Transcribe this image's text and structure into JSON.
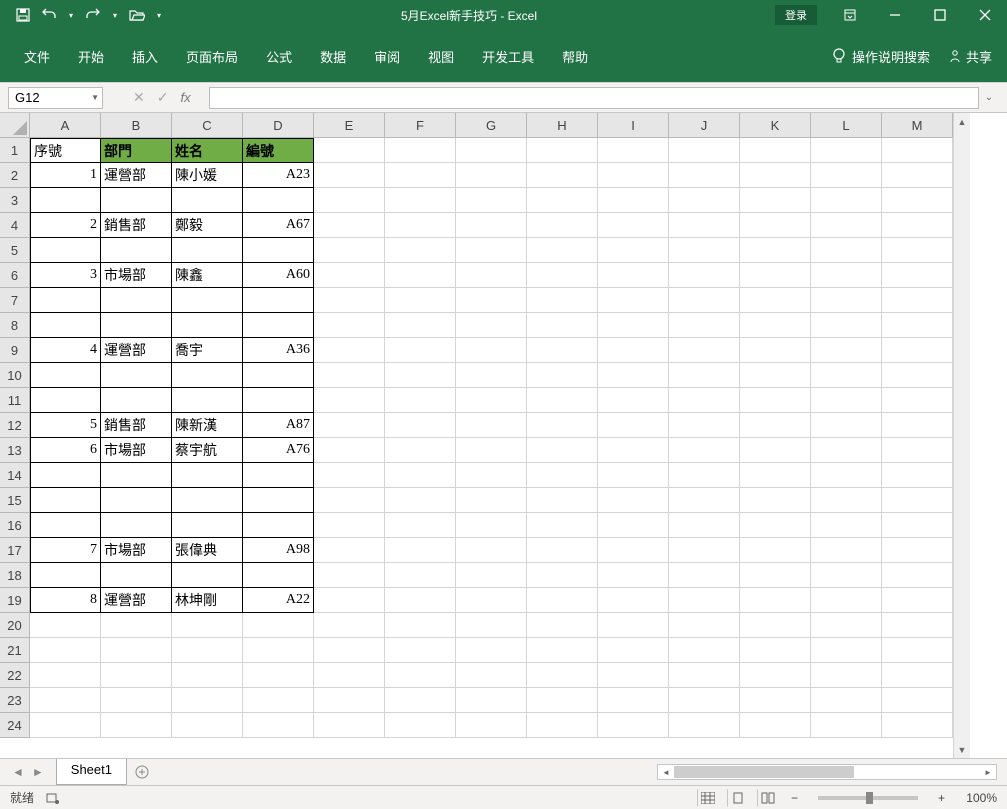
{
  "title": "5月Excel新手技巧 - Excel",
  "login_label": "登录",
  "ribbon_tabs": [
    "文件",
    "开始",
    "插入",
    "页面布局",
    "公式",
    "数据",
    "审阅",
    "视图",
    "开发工具",
    "帮助"
  ],
  "tell_me": "操作说明搜索",
  "share_label": "共享",
  "namebox_value": "G12",
  "formula_value": "",
  "column_headers": [
    "A",
    "B",
    "C",
    "D",
    "E",
    "F",
    "G",
    "H",
    "I",
    "J",
    "K",
    "L",
    "M"
  ],
  "row_count": 24,
  "sheet": {
    "headers": {
      "a": "序號",
      "b": "部門",
      "c": "姓名",
      "d": "編號"
    },
    "rows": [
      {
        "r": 2,
        "a": "1",
        "b": "運營部",
        "c": "陳小媛",
        "d": "A23"
      },
      {
        "r": 3
      },
      {
        "r": 4,
        "a": "2",
        "b": "銷售部",
        "c": "鄭毅",
        "d": "A67"
      },
      {
        "r": 5
      },
      {
        "r": 6,
        "a": "3",
        "b": "市場部",
        "c": "陳鑫",
        "d": "A60"
      },
      {
        "r": 7
      },
      {
        "r": 8
      },
      {
        "r": 9,
        "a": "4",
        "b": "運營部",
        "c": "喬宇",
        "d": "A36"
      },
      {
        "r": 10
      },
      {
        "r": 11
      },
      {
        "r": 12,
        "a": "5",
        "b": "銷售部",
        "c": "陳新漢",
        "d": "A87"
      },
      {
        "r": 13,
        "a": "6",
        "b": "市場部",
        "c": "蔡宇航",
        "d": "A76"
      },
      {
        "r": 14
      },
      {
        "r": 15
      },
      {
        "r": 16
      },
      {
        "r": 17,
        "a": "7",
        "b": "市場部",
        "c": "張偉典",
        "d": "A98"
      },
      {
        "r": 18
      },
      {
        "r": 19,
        "a": "8",
        "b": "運營部",
        "c": "林坤剛",
        "d": "A22"
      }
    ]
  },
  "sheet_tab": "Sheet1",
  "status_ready": "就绪",
  "zoom": "100%"
}
